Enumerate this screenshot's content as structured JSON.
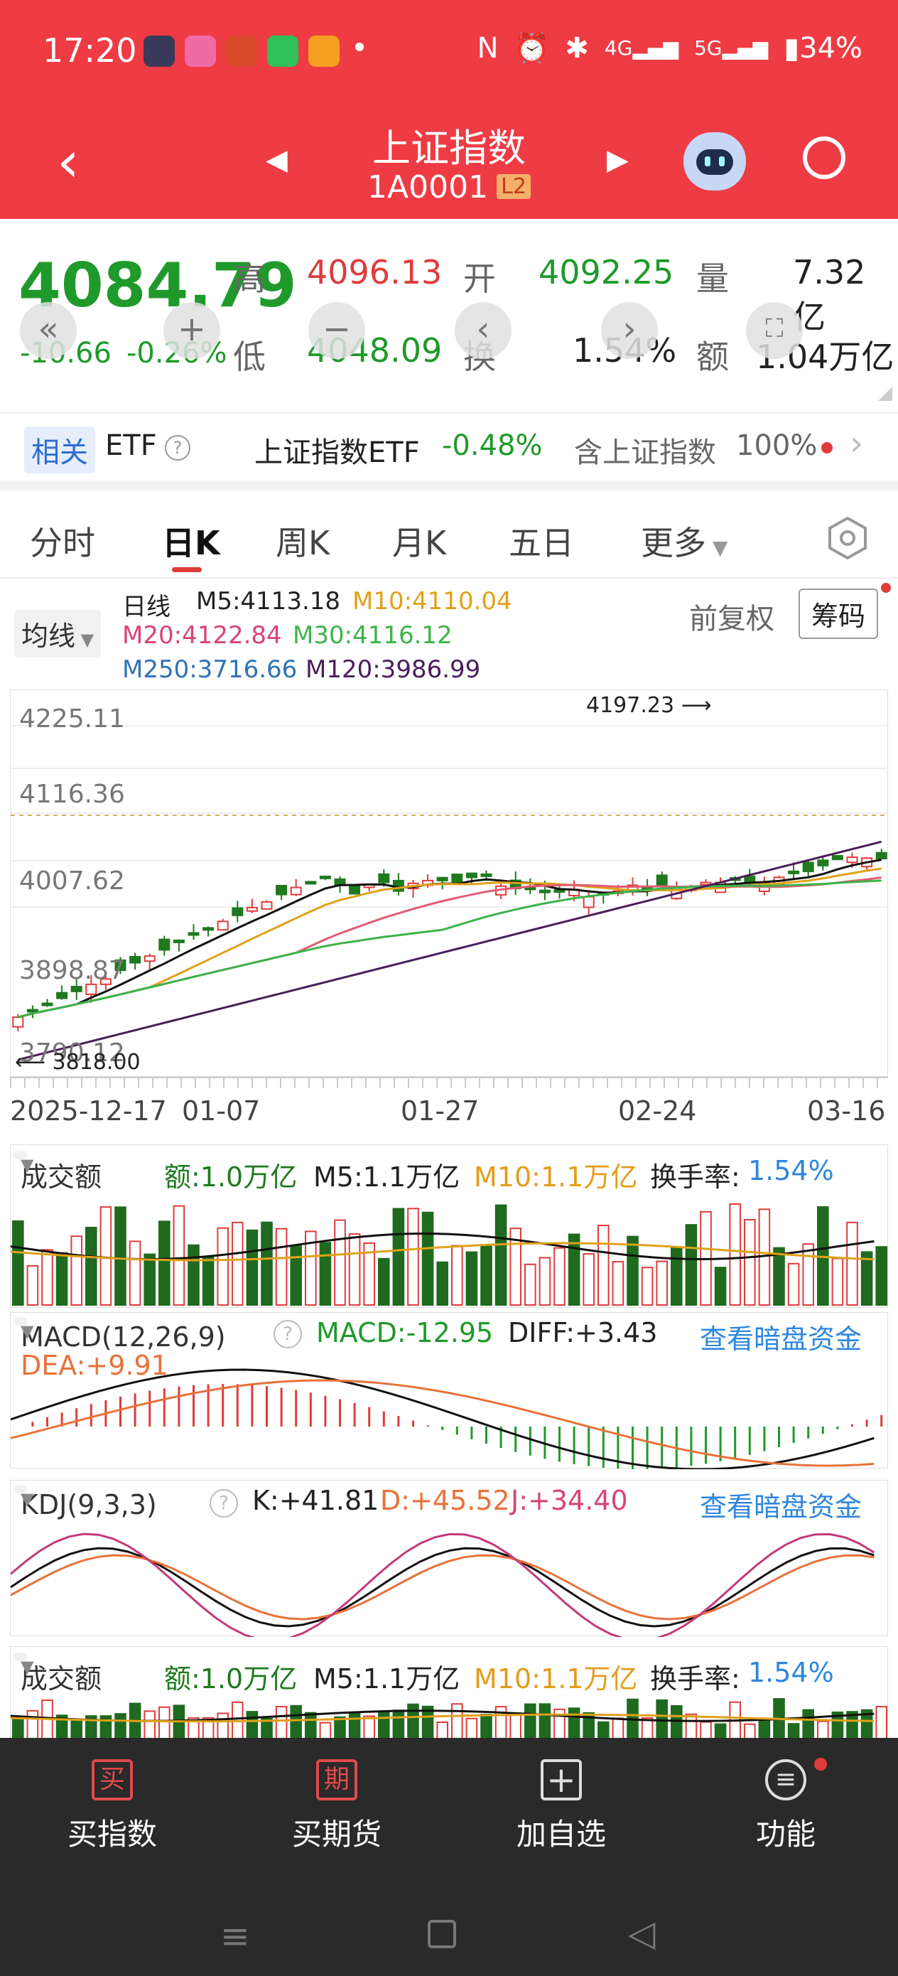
{
  "status_bar": {
    "time": "17:20",
    "network": "4G",
    "network2": "5G",
    "battery": "34%"
  },
  "header": {
    "title": "上证指数",
    "code": "1A0001",
    "level": "L2"
  },
  "quote": {
    "price": "4084.79",
    "change": "-10.66",
    "change_pct": "-0.26%",
    "high_label": "高",
    "high": "4096.13",
    "open_label": "开",
    "open": "4092.25",
    "volume_label": "量",
    "volume": "7.32亿",
    "low_label": "低",
    "low": "4048.09",
    "turnover_label": "换",
    "turnover": "1.54%",
    "amount_label": "额",
    "amount": "1.04万亿"
  },
  "etf_bar": {
    "tag": "相关",
    "etf": "ETF",
    "name": "上证指数ETF",
    "change": "-0.48%",
    "contains": "含上证指数",
    "pct": "100%"
  },
  "tabs": [
    "分时",
    "日K",
    "周K",
    "月K",
    "五日",
    "更多"
  ],
  "ma": {
    "selector": "均线",
    "period": "日线",
    "m5": "M5:4113.18",
    "m10": "M10:4110.04",
    "m20": "M20:4122.84",
    "m30": "M30:4116.12",
    "m250": "M250:3716.66",
    "m120": "M120:3986.99",
    "fuquan": "前复权",
    "chouma": "筹码"
  },
  "kline": {
    "y_labels": [
      "4225.11",
      "4116.36",
      "4007.62",
      "3898.87",
      "3790.12"
    ],
    "max_label": "4197.23",
    "min_label": "3818.00"
  },
  "dates": [
    "2025-12-17",
    "01-07",
    "01-27",
    "02-24",
    "03-16"
  ],
  "volume_panel": {
    "selector": "成交额",
    "amount": "额:1.0万亿",
    "m5": "M5:1.1万亿",
    "m10": "M10:1.1万亿",
    "turn_label": "换手率:",
    "turn": "1.54%"
  },
  "macd_panel": {
    "selector": "MACD(12,26,9)",
    "macd": "MACD:-12.95",
    "diff": "DIFF:+3.43",
    "dea": "DEA:+9.91",
    "link": "查看暗盘资金"
  },
  "kdj_panel": {
    "selector": "KDJ(9,3,3)",
    "k": "K:+41.81",
    "d": "D:+45.52",
    "j": "J:+34.40",
    "link": "查看暗盘资金"
  },
  "volume_panel2": {
    "selector": "成交额",
    "amount": "额:1.0万亿",
    "m5": "M5:1.1万亿",
    "m10": "M10:1.1万亿",
    "turn_label": "换手率:",
    "turn": "1.54%"
  },
  "bottom_bar": [
    {
      "icon": "买",
      "label": "买指数"
    },
    {
      "icon": "期",
      "label": "买期货"
    },
    {
      "icon": "+",
      "label": "加自选"
    },
    {
      "icon": "≡",
      "label": "功能"
    }
  ],
  "colors": {
    "brand": "#ef3b43",
    "up": "#e03b3b",
    "down": "#1f7a1f"
  }
}
